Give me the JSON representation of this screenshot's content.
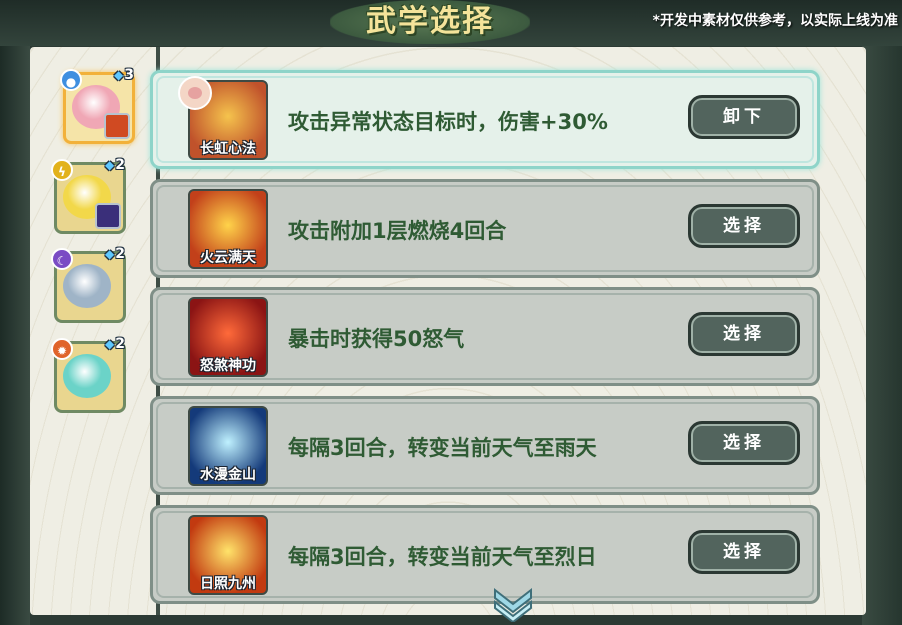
{
  "header": {
    "title": "武学选择",
    "notice": "*开发中素材仅供参考，以实际上线为准"
  },
  "pets": [
    {
      "element_icon": "water-drop-icon",
      "element_color": "#3f8fe0",
      "level": "3",
      "face_color": "#f0a7b5",
      "selected": true,
      "mini_skill_color": "#d04a22"
    },
    {
      "element_icon": "lightning-icon",
      "element_color": "#e2b21c",
      "level": "2",
      "face_color": "#f2d84a",
      "selected": false,
      "mini_skill_color": "#3a2f7a"
    },
    {
      "element_icon": "moon-icon",
      "element_color": "#7a4bc4",
      "level": "2",
      "face_color": "#9fb4c7",
      "selected": false,
      "mini_skill_color": ""
    },
    {
      "element_icon": "sun-icon",
      "element_color": "#e0642a",
      "level": "2",
      "face_color": "#6bd3c8",
      "selected": false,
      "mini_skill_color": ""
    }
  ],
  "skills": [
    {
      "name": "长虹心法",
      "description": "攻击异常状态目标时，伤害+30%",
      "button": "卸下",
      "equipped": true,
      "icon_colors": [
        "#f5c34d",
        "#c0522b"
      ]
    },
    {
      "name": "火云满天",
      "description": "攻击附加1层燃烧4回合",
      "button": "选择",
      "equipped": false,
      "icon_colors": [
        "#ffd34a",
        "#c2401a"
      ]
    },
    {
      "name": "怒煞神功",
      "description": "暴击时获得50怒气",
      "button": "选择",
      "equipped": false,
      "icon_colors": [
        "#ff6a3a",
        "#8b1414"
      ]
    },
    {
      "name": "水漫金山",
      "description": "每隔3回合，转变当前天气至雨天",
      "button": "选择",
      "equipped": false,
      "icon_colors": [
        "#bff1ff",
        "#143a7a"
      ]
    },
    {
      "name": "日照九州",
      "description": "每隔3回合，转变当前天气至烈日",
      "button": "选择",
      "equipped": false,
      "icon_colors": [
        "#ffe36a",
        "#c23a10"
      ]
    }
  ]
}
